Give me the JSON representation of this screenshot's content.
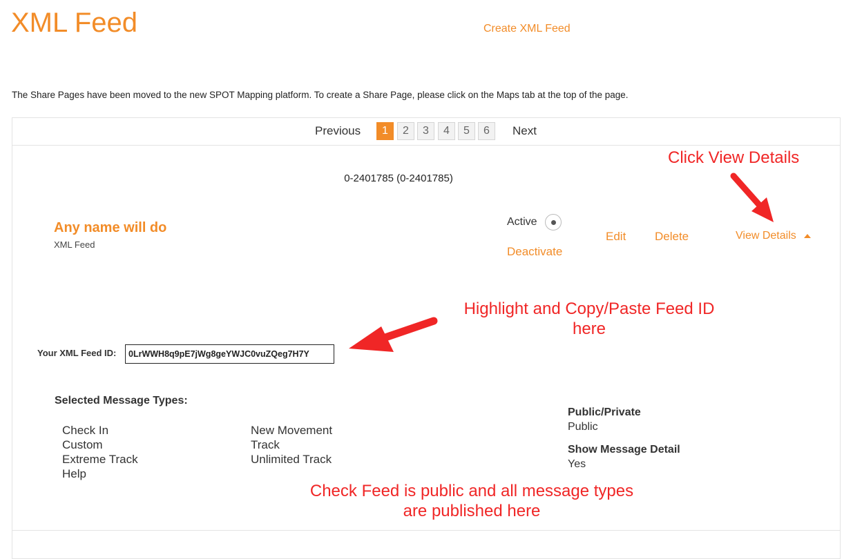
{
  "header": {
    "title": "XML Feed",
    "create_link": "Create XML Feed"
  },
  "notice": "The Share Pages have been moved to the new SPOT Mapping platform. To create a Share Page, please click on the Maps tab at the top of the page.",
  "pagination": {
    "previous_label": "Previous",
    "next_label": "Next",
    "pages": [
      "1",
      "2",
      "3",
      "4",
      "5",
      "6"
    ],
    "current_page": 1
  },
  "feed": {
    "device_id": "0-2401785 (0-2401785)",
    "name": "Any name will do",
    "type": "XML Feed",
    "status_label": "Active",
    "status_selected": true,
    "actions": {
      "deactivate": "Deactivate",
      "edit": "Edit",
      "delete": "Delete",
      "view_details": "View Details"
    },
    "id_label": "Your XML Feed ID:",
    "id_value": "0LrWWH8q9pE7jWg8geYWJC0vuZQeg7H7Y",
    "message_types_title": "Selected Message Types:",
    "message_types_col1": [
      "Check In",
      "Custom",
      "Extreme Track",
      "Help"
    ],
    "message_types_col2": [
      "New Movement",
      "Track",
      "Unlimited Track"
    ],
    "public_private_label": "Public/Private",
    "public_private_value": "Public",
    "show_detail_label": "Show Message Detail",
    "show_detail_value": "Yes"
  },
  "annotations": {
    "view_details": "Click View Details",
    "copy_line1": "Highlight and Copy/Paste Feed ID",
    "copy_line2": "here",
    "check_line1": "Check Feed is public and all message types",
    "check_line2": "are published here"
  },
  "colors": {
    "brand_orange": "#f28c28",
    "annotation_red": "#f02626"
  }
}
